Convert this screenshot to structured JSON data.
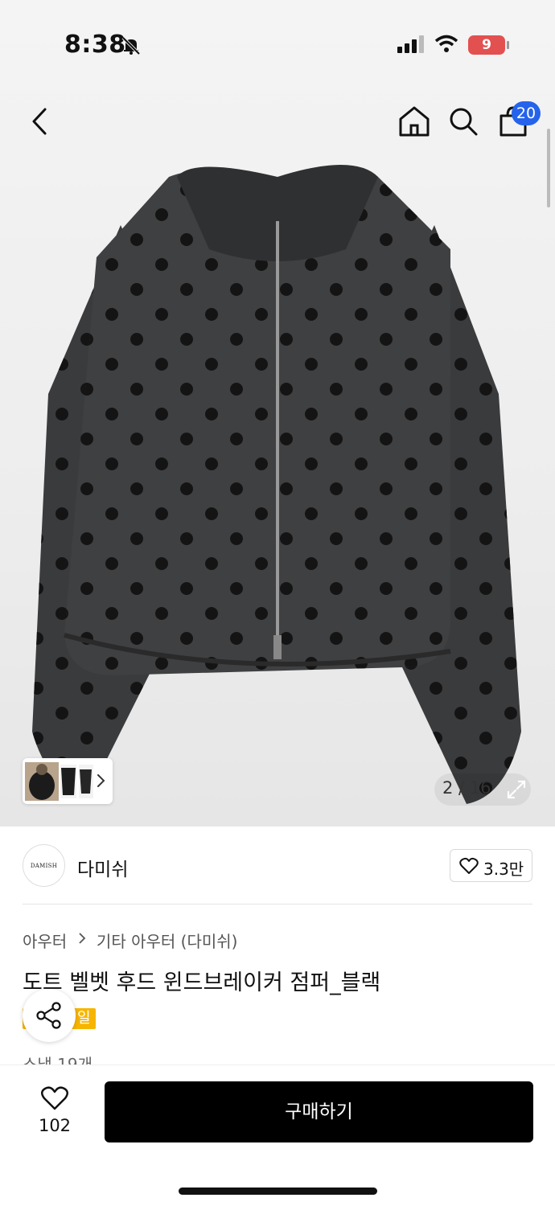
{
  "status_bar": {
    "time": "8:38",
    "battery": "9"
  },
  "nav": {
    "cart_count": "20"
  },
  "gallery": {
    "counter": "2 / 16"
  },
  "brand": {
    "logo_text": "DAMISH",
    "name": "다미쉬",
    "likes": "3.3만"
  },
  "product": {
    "breadcrumb": [
      "아우터",
      "기타 아우터 (다미쉬)"
    ],
    "title": "도트 벨벳 후드 윈드브레이커 점퍼_블랙",
    "tag": "일",
    "review_count": "스냅 19개"
  },
  "bottom": {
    "wish_count": "102",
    "buy_label": "구매하기"
  },
  "colors": {
    "accent": "#2563eb",
    "buy_button": "#000000",
    "tag": "#f7b500",
    "battery": "#e35050"
  },
  "icons": [
    "bell-slash-icon",
    "signal-icon",
    "wifi-icon",
    "back-icon",
    "home-icon",
    "search-icon",
    "cart-icon",
    "chevron-right-icon",
    "expand-icon",
    "heart-icon",
    "share-icon"
  ]
}
